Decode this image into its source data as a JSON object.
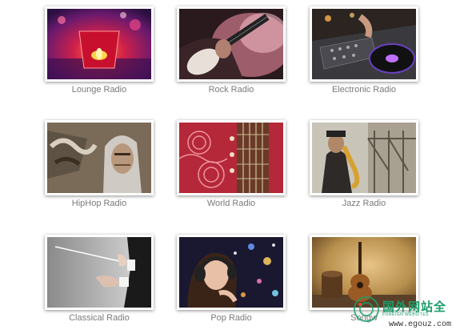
{
  "stations": [
    {
      "label": "Lounge Radio",
      "icon": "candle-lounge-photo"
    },
    {
      "label": "Rock Radio",
      "icon": "electric-guitar-photo"
    },
    {
      "label": "Electronic Radio",
      "icon": "dj-turntable-photo"
    },
    {
      "label": "HipHop Radio",
      "icon": "hooded-man-graffiti-photo"
    },
    {
      "label": "World Radio",
      "icon": "sitar-photo"
    },
    {
      "label": "Jazz Radio",
      "icon": "saxophone-player-photo"
    },
    {
      "label": "Classical Radio",
      "icon": "conductor-baton-photo"
    },
    {
      "label": "Pop Radio",
      "icon": "headphones-girl-photo"
    },
    {
      "label": "Songw",
      "icon": "acoustic-guitar-photo"
    }
  ],
  "watermark": {
    "text": "国外网站全",
    "sub": "FOREIGN WEBSITES",
    "url": "www.egouz.com"
  }
}
